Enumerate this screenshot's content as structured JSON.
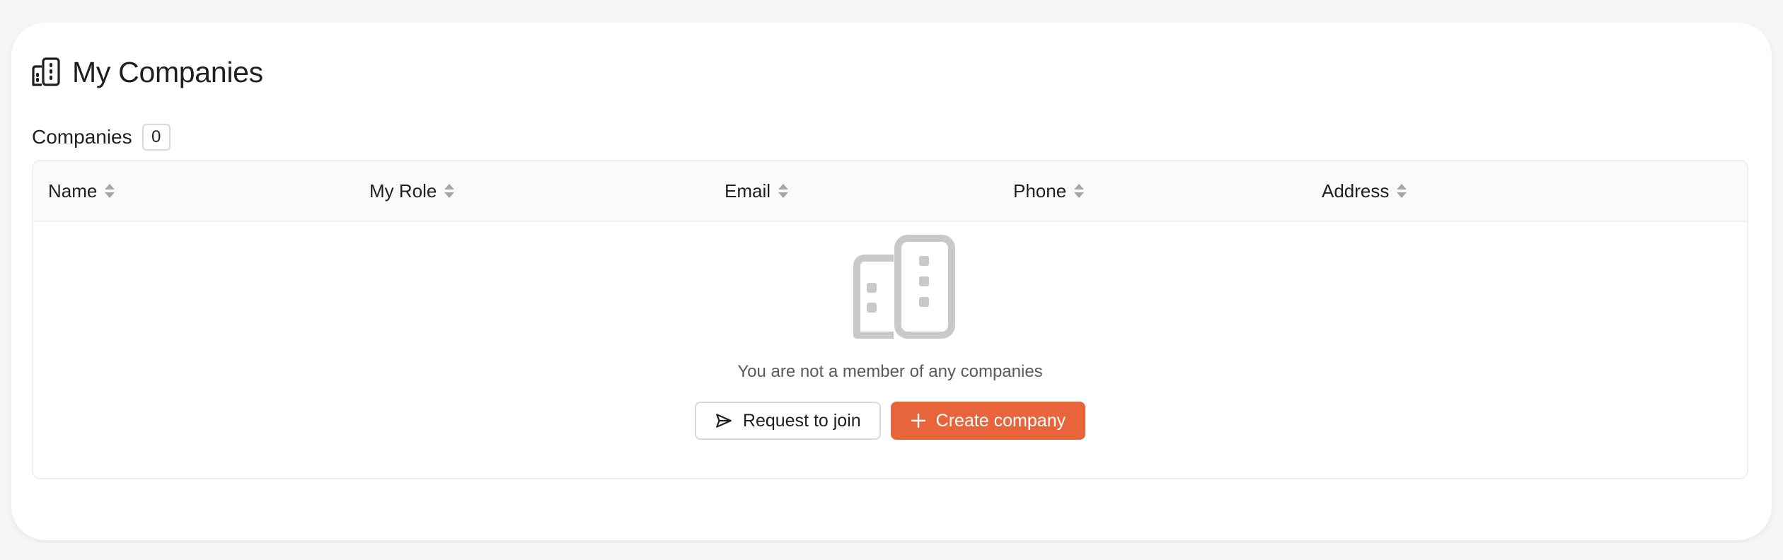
{
  "page": {
    "title": "My Companies",
    "title_icon": "building-icon"
  },
  "companies": {
    "label": "Companies",
    "count": "0"
  },
  "table": {
    "columns": [
      {
        "label": "Name",
        "sort_icon": "sort-icon"
      },
      {
        "label": "My Role",
        "sort_icon": "sort-icon"
      },
      {
        "label": "Email",
        "sort_icon": "sort-icon"
      },
      {
        "label": "Phone",
        "sort_icon": "sort-icon"
      },
      {
        "label": "Address",
        "sort_icon": "sort-icon"
      }
    ],
    "rows": []
  },
  "empty_state": {
    "illustration_icon": "building-icon",
    "message": "You are not a member of any companies",
    "request_button": {
      "label": "Request to join",
      "icon": "send-icon"
    },
    "create_button": {
      "label": "Create company",
      "icon": "plus-icon"
    }
  },
  "colors": {
    "primary": "#e8643a",
    "muted_icon": "#c9c9c9",
    "border": "#d9d9d9"
  }
}
